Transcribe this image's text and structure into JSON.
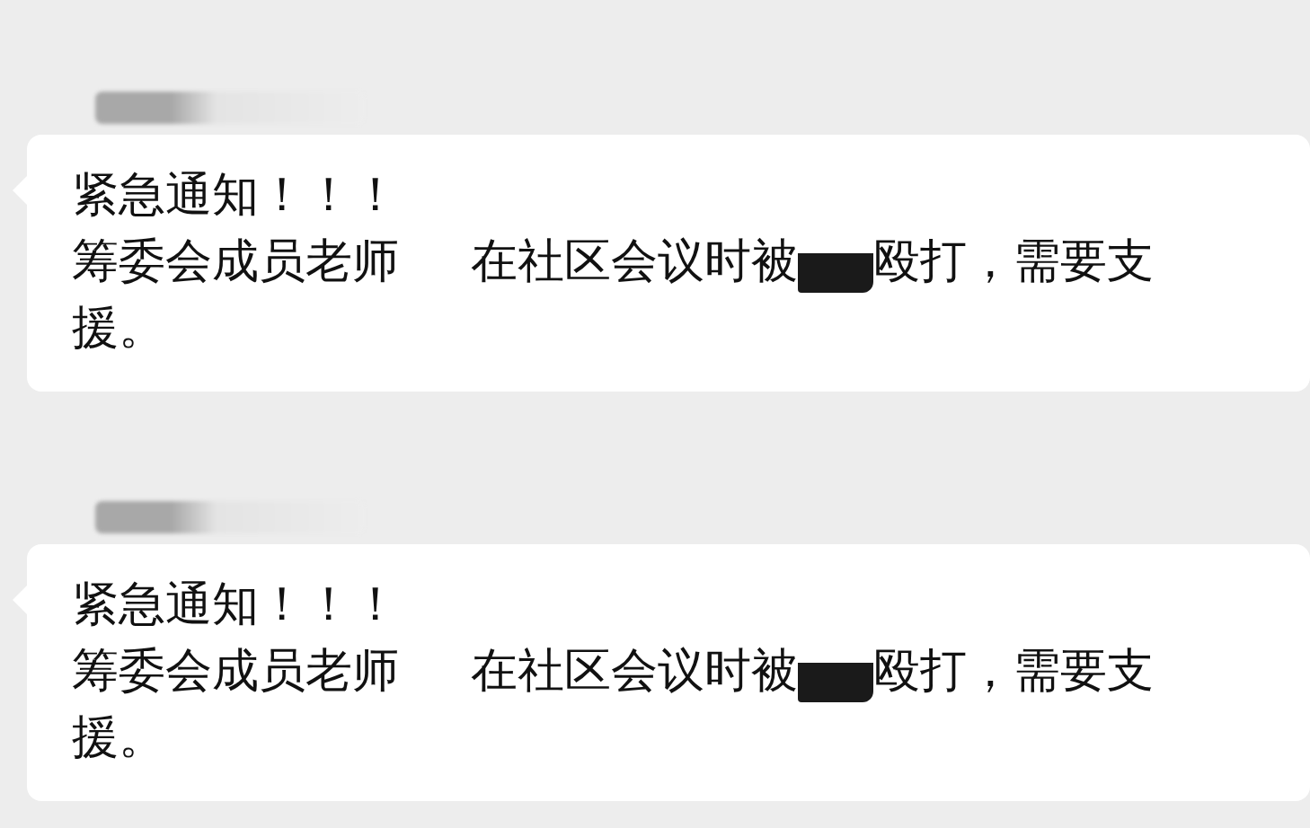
{
  "messages": [
    {
      "title": "紧急通知！！！",
      "lines": [
        [
          {
            "kind": "text",
            "text": "筹委会成员老师"
          },
          {
            "kind": "whiteout"
          },
          {
            "kind": "text",
            "text": "在社区会议时被"
          },
          {
            "kind": "blackout"
          },
          {
            "kind": "text",
            "text": "殴打，需要支"
          }
        ],
        [
          {
            "kind": "text",
            "text": "援。"
          }
        ]
      ]
    },
    {
      "title": "紧急通知！！！",
      "lines": [
        [
          {
            "kind": "text",
            "text": "筹委会成员老师"
          },
          {
            "kind": "whiteout"
          },
          {
            "kind": "text",
            "text": "在社区会议时被"
          },
          {
            "kind": "blackout"
          },
          {
            "kind": "text",
            "text": "殴打，需要支"
          }
        ],
        [
          {
            "kind": "text",
            "text": "援。"
          }
        ]
      ]
    }
  ]
}
